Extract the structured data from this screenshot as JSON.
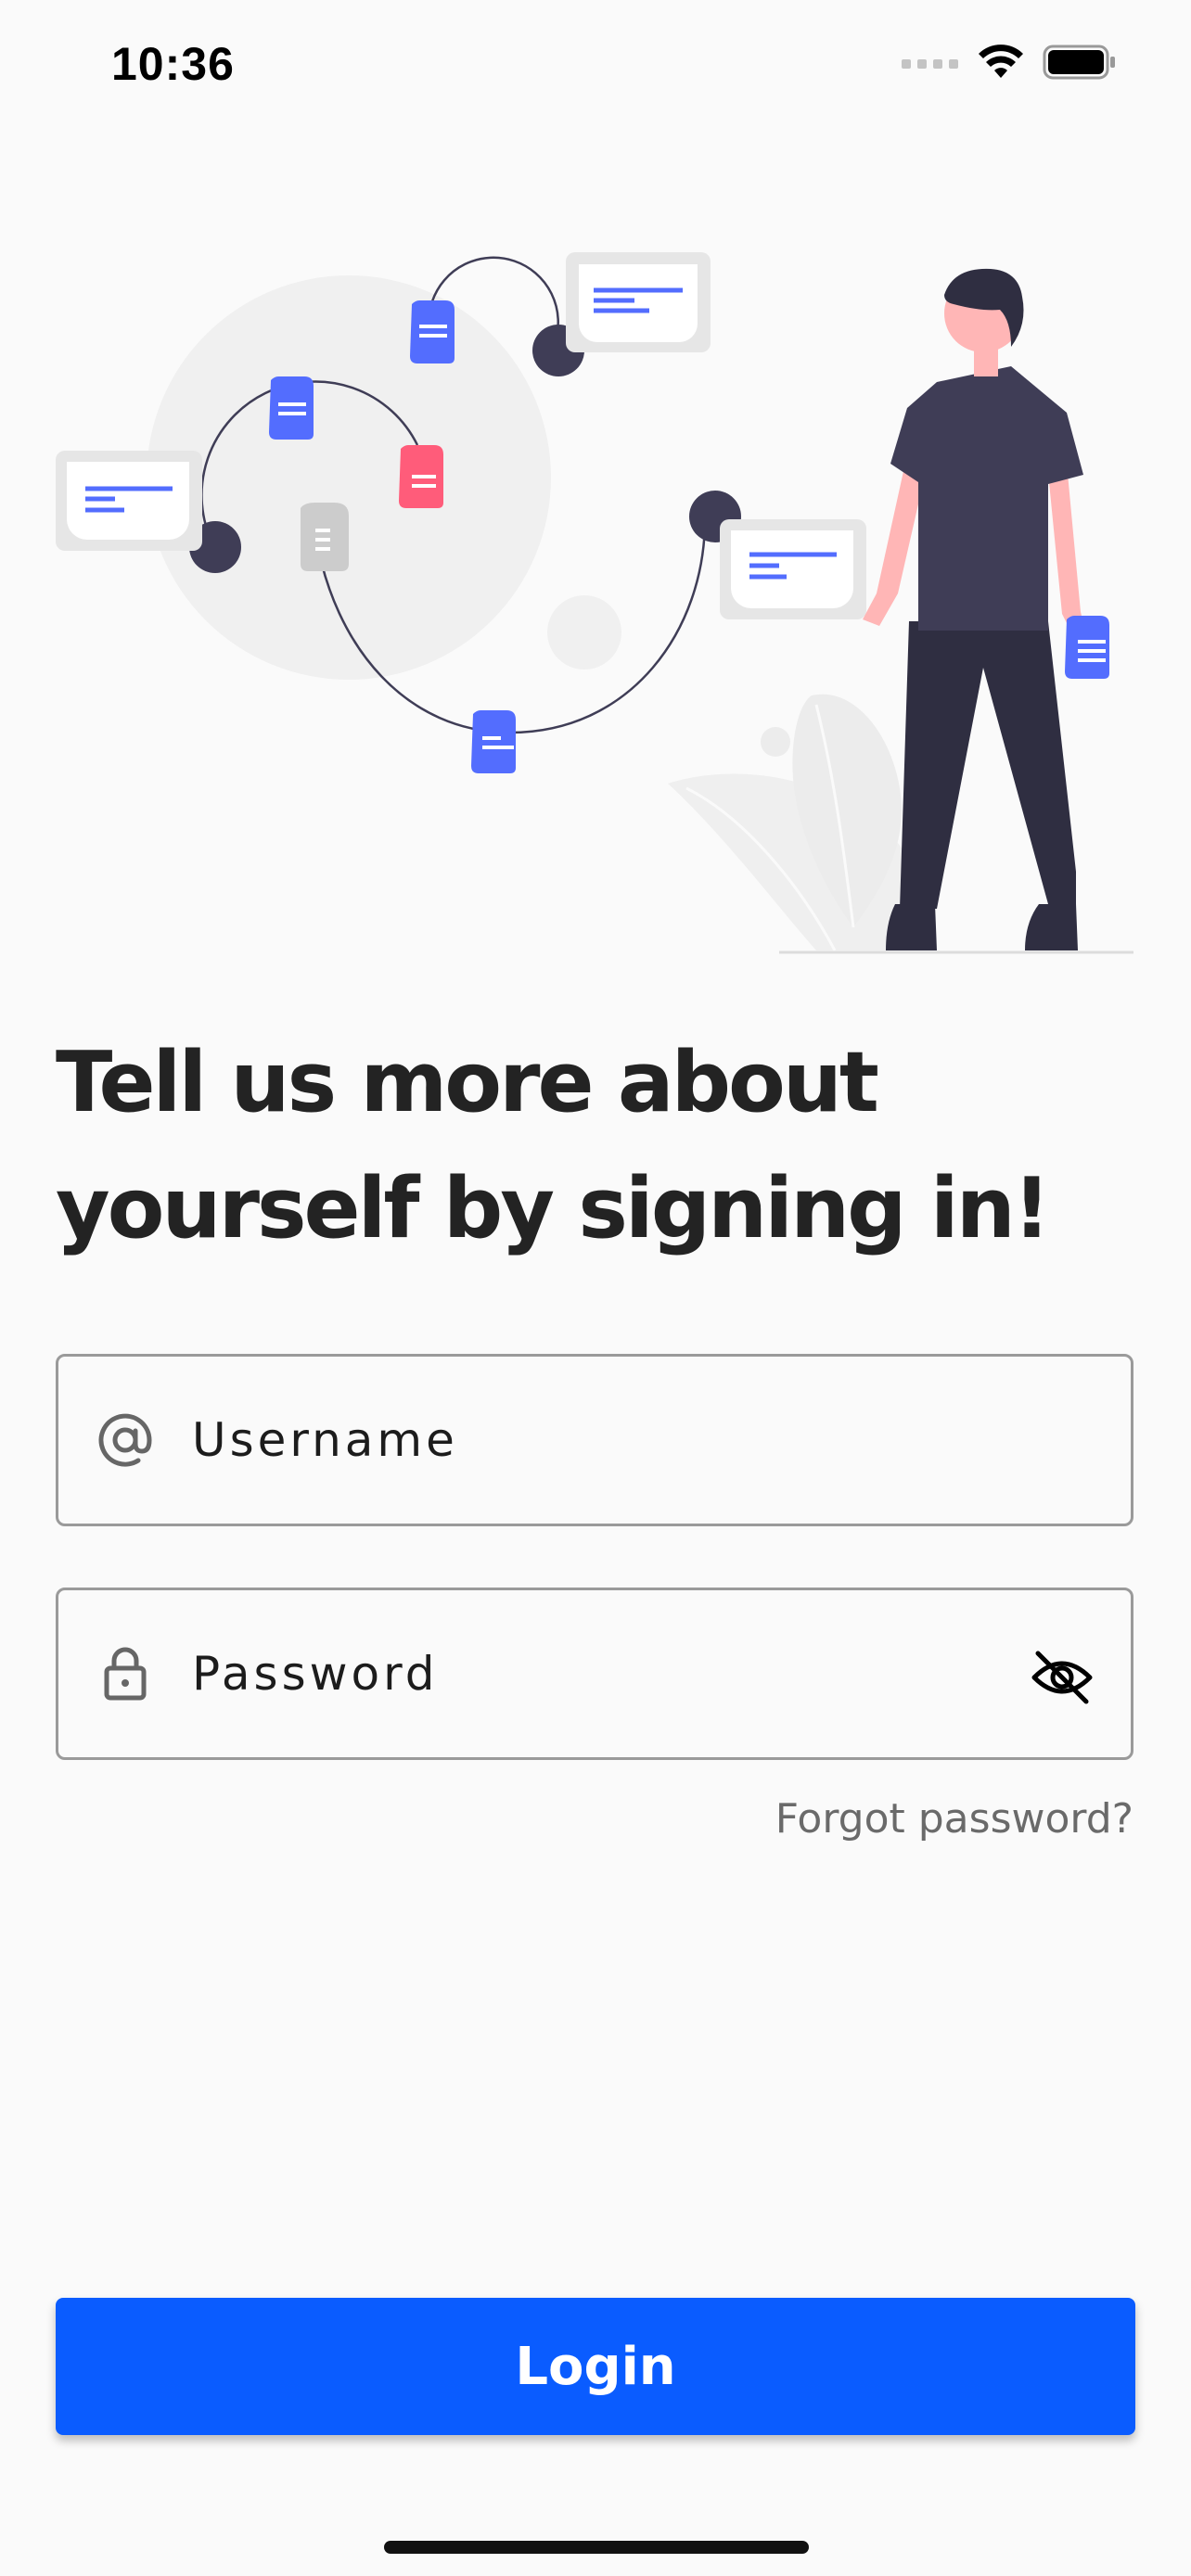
{
  "status_bar": {
    "time": "10:36",
    "icons": [
      "signal-icon",
      "wifi-icon",
      "battery-icon"
    ]
  },
  "illustration": {
    "description_icon": "signing-in-illustration"
  },
  "headline": "Tell us more about yourself by signing in!",
  "form": {
    "username": {
      "placeholder": "Username",
      "value": "",
      "icon": "at-sign-icon"
    },
    "password": {
      "placeholder": "Password",
      "value": "",
      "icon": "lock-icon",
      "toggle_icon": "eye-off-icon"
    },
    "forgot_label": "Forgot password?"
  },
  "login_label": "Login",
  "colors": {
    "primary": "#0a5cff",
    "background": "#fafafa",
    "illustration_accent": "#536dfe",
    "illustration_highlight": "#ff5c7a",
    "illustration_dark": "#3f3d56"
  }
}
